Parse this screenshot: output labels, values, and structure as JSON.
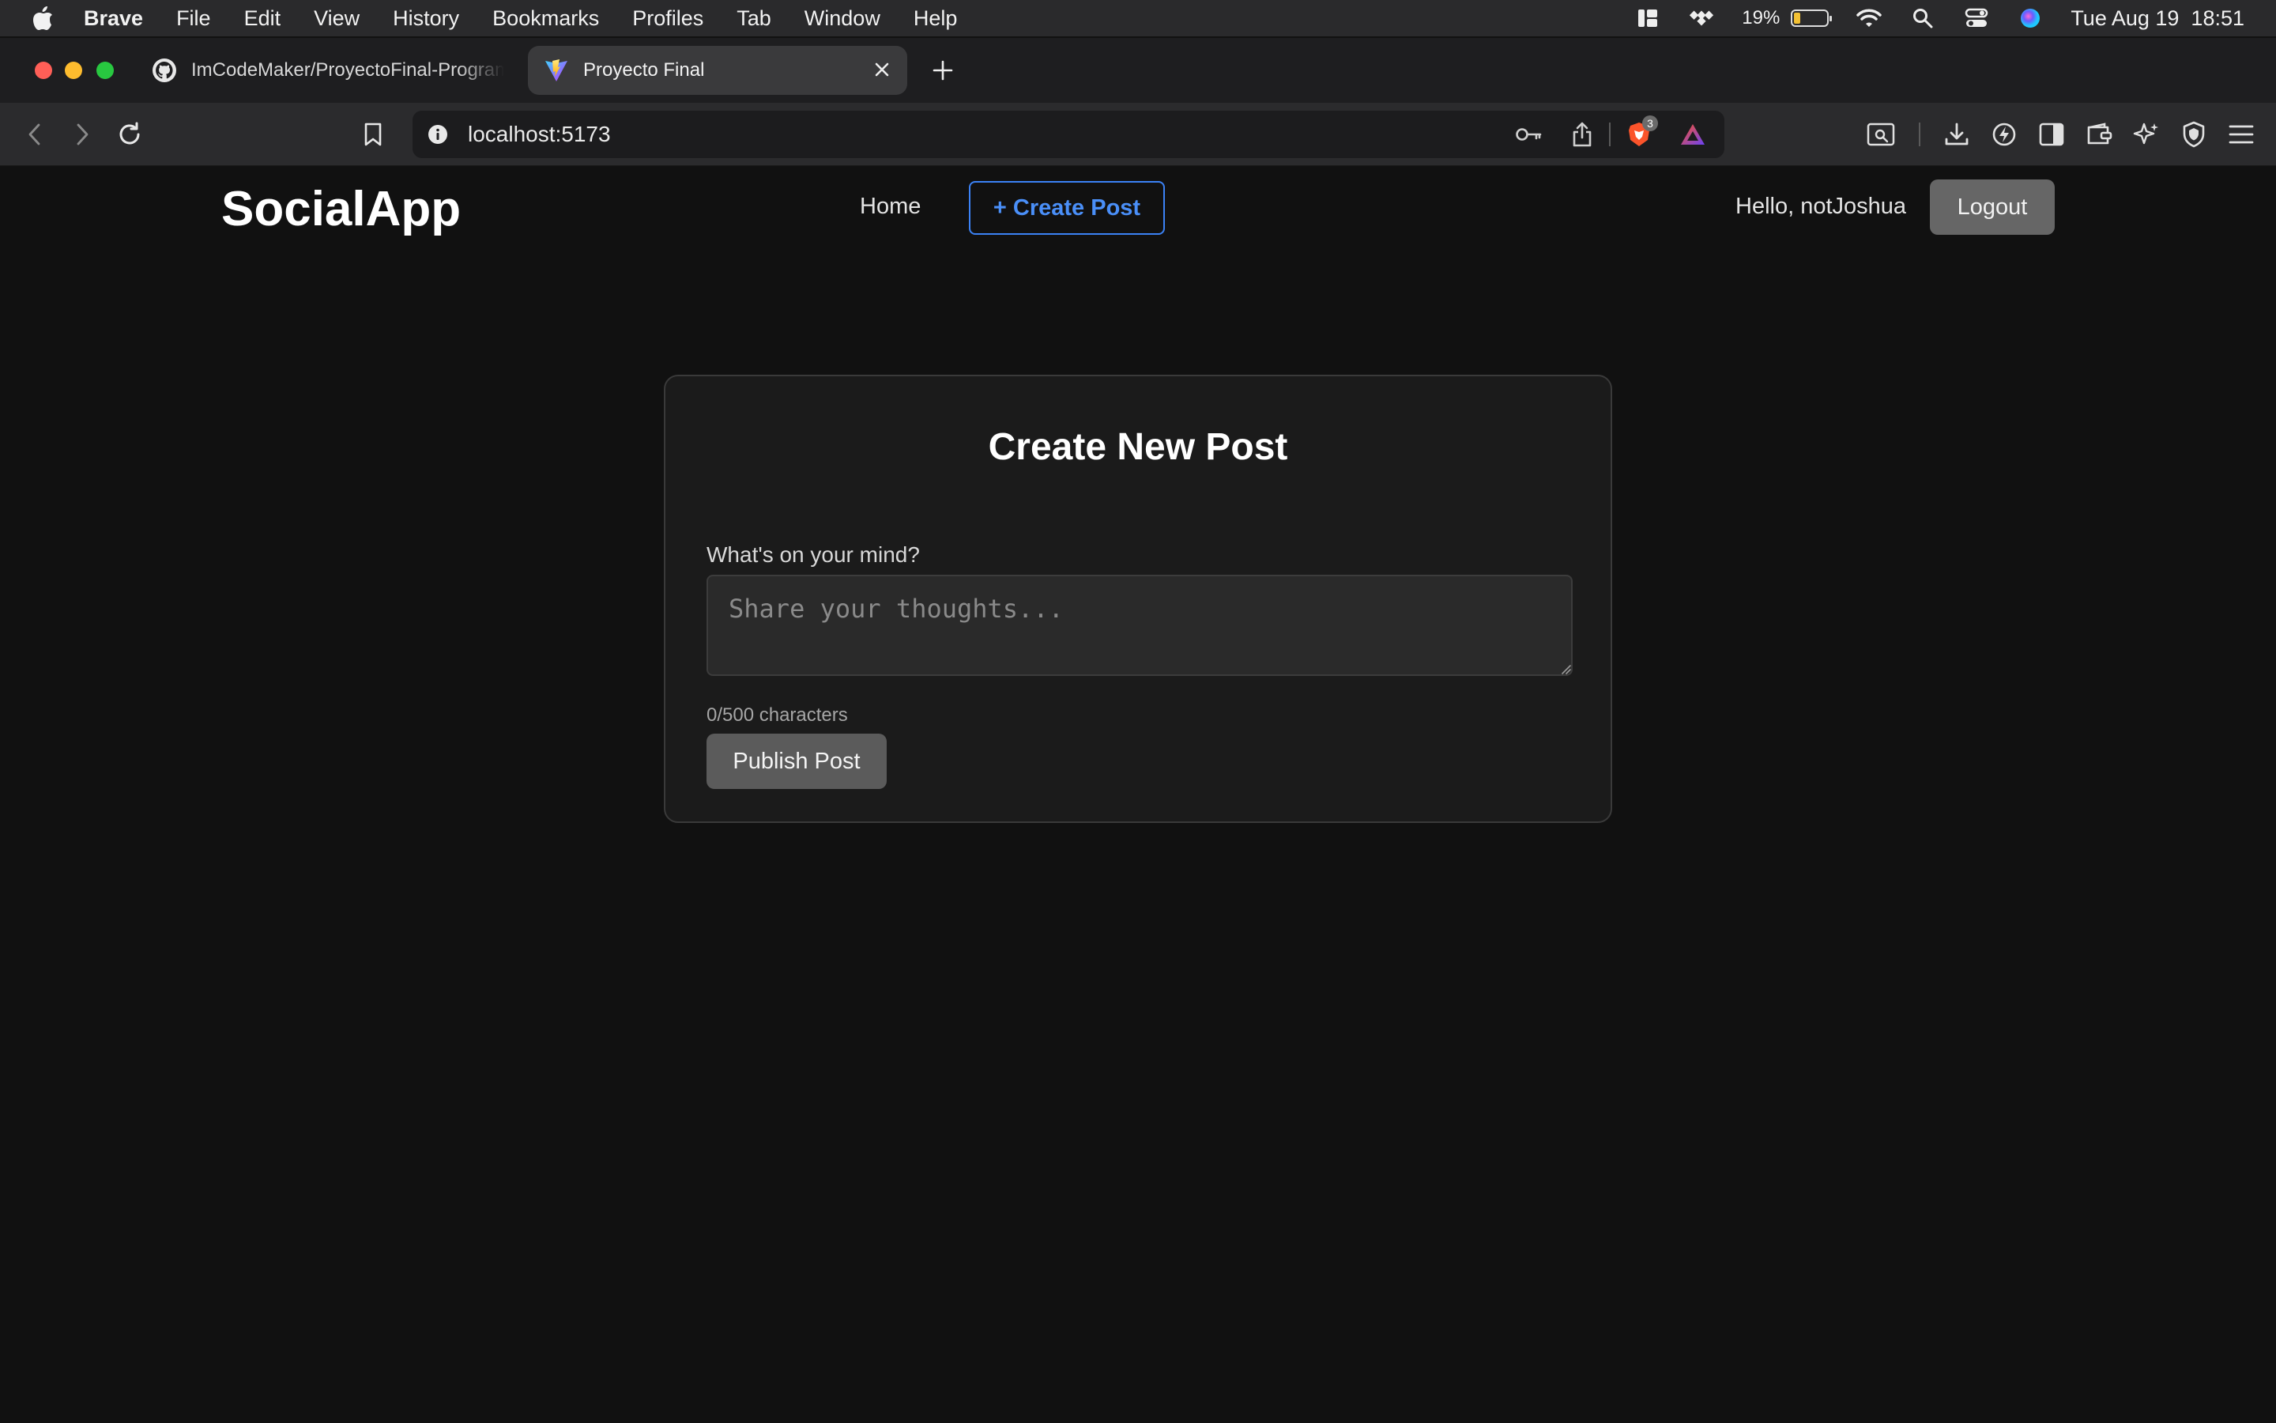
{
  "menubar": {
    "app_name": "Brave",
    "items": [
      "File",
      "Edit",
      "View",
      "History",
      "Bookmarks",
      "Profiles",
      "Tab",
      "Window",
      "Help"
    ],
    "battery_percent": "19%",
    "datetime": "Tue Aug 19  18:51"
  },
  "tabs": [
    {
      "title": "ImCodeMaker/ProyectoFinal-Programacion",
      "icon": "github-icon"
    },
    {
      "title": "Proyecto Final",
      "icon": "vite-icon",
      "active": true
    }
  ],
  "toolbar": {
    "url": "localhost:5173",
    "shields_count": "3"
  },
  "app": {
    "brand": "SocialApp",
    "nav_home": "Home",
    "nav_create": "+ Create Post",
    "greeting": "Hello, notJoshua",
    "logout": "Logout"
  },
  "create_post": {
    "title": "Create New Post",
    "label": "What's on your mind?",
    "placeholder": "Share your thoughts...",
    "char_count": "0/500 characters",
    "submit": "Publish Post"
  },
  "colors": {
    "accent": "#3b82f6",
    "page_bg": "#111111",
    "card_bg": "#1b1b1b"
  }
}
